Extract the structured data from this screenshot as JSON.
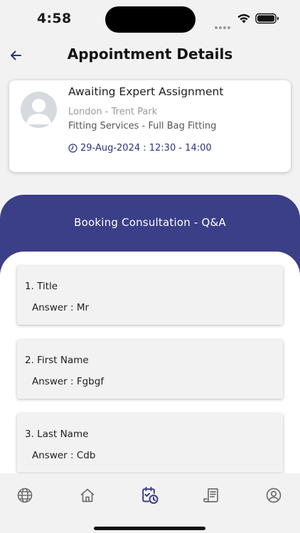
{
  "status_bar": {
    "time": "4:58"
  },
  "header": {
    "title": "Appointment Details"
  },
  "appointment": {
    "status": "Awaiting Expert Assignment",
    "location": "London - Trent Park",
    "service": "Fitting Services - Full Bag Fitting",
    "datetime": "29-Aug-2024 : 12:30 - 14:00"
  },
  "qa": {
    "title": "Booking Consultation - Q&A",
    "items": [
      {
        "question": "1. Title",
        "answer": "Answer : Mr"
      },
      {
        "question": "2. First Name",
        "answer": "Answer : Fgbgf"
      },
      {
        "question": "3. Last Name",
        "answer": "Answer : Cdb"
      }
    ]
  },
  "tab_bar": {
    "tabs": [
      {
        "icon": "globe-icon"
      },
      {
        "icon": "home-icon"
      },
      {
        "icon": "calendar-clock-icon",
        "active": true
      },
      {
        "icon": "receipt-icon"
      },
      {
        "icon": "profile-icon"
      }
    ]
  },
  "colors": {
    "accent": "#3b3f87",
    "inactive_icon": "#6f6f6f",
    "background": "#f2f2f2"
  }
}
